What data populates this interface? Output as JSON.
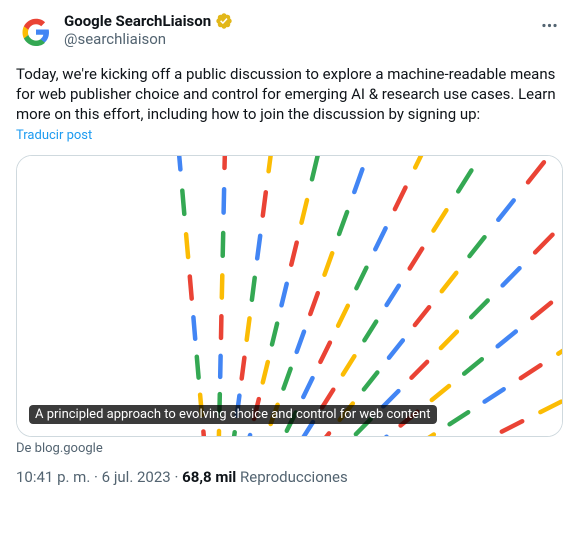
{
  "user": {
    "display_name": "Google SearchLiaison",
    "handle": "@searchliaison",
    "verified": true
  },
  "tweet_text": "Today, we're kicking off a public discussion to explore a machine-readable means for web publisher choice and control for emerging AI & research use cases. Learn more on this effort, including how to join the discussion by signing up:",
  "translate_label": "Traducir post",
  "card": {
    "caption": "A principled approach to evolving choice and control for web content",
    "source": "De blog.google"
  },
  "meta": {
    "time": "10:41 p. m.",
    "date": "6 jul. 2023",
    "views_count": "68,8 mil",
    "views_label": "Reproducciones"
  },
  "colors": {
    "blue": "#4285F4",
    "red": "#EA4335",
    "yellow": "#FBBC04",
    "green": "#34A853"
  }
}
